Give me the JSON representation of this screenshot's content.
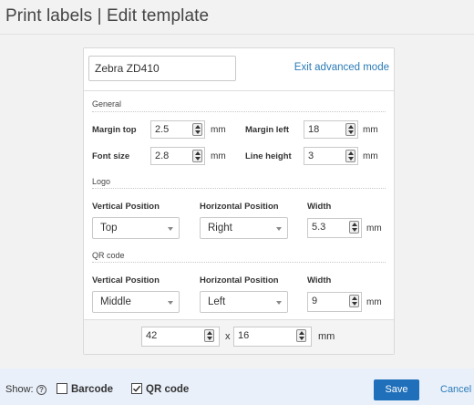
{
  "header": {
    "title": "Print labels | Edit template"
  },
  "printer": {
    "value": "Zebra ZD410"
  },
  "exit_link": "Exit advanced mode",
  "general": {
    "label": "General",
    "margin_top": {
      "label": "Margin top",
      "value": "2.5",
      "unit": "mm"
    },
    "margin_left": {
      "label": "Margin left",
      "value": "18",
      "unit": "mm"
    },
    "font_size": {
      "label": "Font size",
      "value": "2.8",
      "unit": "mm"
    },
    "line_height": {
      "label": "Line height",
      "value": "3",
      "unit": "mm"
    }
  },
  "logo": {
    "label": "Logo",
    "vertical_label": "Vertical Position",
    "vertical_value": "Top",
    "horizontal_label": "Horizontal Position",
    "horizontal_value": "Right",
    "width_label": "Width",
    "width_value": "5.3",
    "unit": "mm"
  },
  "qr": {
    "label": "QR code",
    "vertical_label": "Vertical Position",
    "vertical_value": "Middle",
    "horizontal_label": "Horizontal Position",
    "horizontal_value": "Left",
    "width_label": "Width",
    "width_value": "9",
    "unit": "mm"
  },
  "label_size": {
    "width": "42",
    "separator": "x",
    "height": "16",
    "unit": "mm"
  },
  "footer": {
    "show_label": "Show:",
    "help_icon": "?",
    "barcode_label": "Barcode",
    "barcode_checked": false,
    "qr_label": "QR code",
    "qr_checked": true,
    "save_label": "Save",
    "cancel_label": "Cancel"
  },
  "colors": {
    "accent": "#1f6fba",
    "link": "#2a7bb8",
    "footer_bg": "#e9f0fa"
  }
}
